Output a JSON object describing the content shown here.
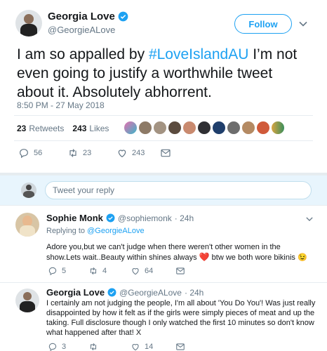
{
  "main_tweet": {
    "author_name": "Georgia Love",
    "author_handle": "@GeorgieALove",
    "follow_label": "Follow",
    "text_before": "I am so appalled by ",
    "hashtag": "#LoveIslandAU",
    "text_after": " I’m not even going to justify a worthwhile tweet about it. Absolutely abhorrent.",
    "timestamp": "8:50 PM - 27 May 2018",
    "retweets_count": "23",
    "retweets_label": "Retweets",
    "likes_count": "243",
    "likes_label": "Likes",
    "actions": {
      "replies": "56",
      "retweets": "23",
      "likes": "243"
    }
  },
  "reply_box": {
    "placeholder": "Tweet your reply"
  },
  "replies": [
    {
      "author_name": "Sophie Monk",
      "author_handle": "@sophiemonk",
      "time": "· 24h",
      "replying_to_label": "Replying to",
      "replying_to_handle": "@GeorgieALove",
      "text_before": "Adore you,but we can't judge when there weren't other women in the show.Lets wait..Beauty within shines always ",
      "text_after": " btw we both wore bikinis 😉",
      "heart_emoji": "❤️",
      "actions": {
        "replies": "5",
        "retweets": "4",
        "likes": "64"
      }
    },
    {
      "author_name": "Georgia Love",
      "author_handle": "@GeorgieALove",
      "time": "· 24h",
      "text": "I certainly am not judging the people, I'm all about 'You Do You'! Was just really disappointed by how it felt as if the girls were simply pieces of meat and up the taking. Full disclosure though I only watched the first 10 minutes so don't know what happened after that! X",
      "actions": {
        "replies": "3",
        "retweets": "",
        "likes": "14"
      }
    }
  ],
  "colors": {
    "accent": "#1da1f2",
    "text": "#14171a",
    "muted": "#657786",
    "border": "#e6ecf0",
    "reply_bg": "#e8f5fd",
    "heart": "#e0245e"
  }
}
